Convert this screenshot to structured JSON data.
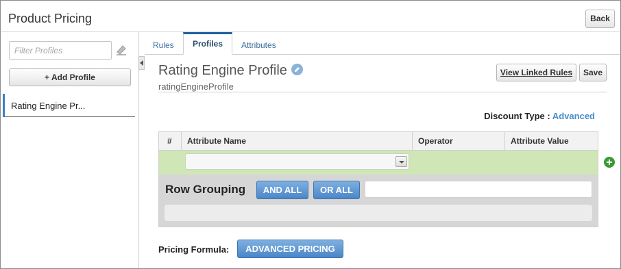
{
  "header": {
    "title": "Product Pricing",
    "back_label": "Back"
  },
  "sidebar": {
    "filter_placeholder": "Filter Profiles",
    "add_label": "+ Add Profile",
    "items": [
      {
        "label": "Rating Engine Pr..."
      }
    ]
  },
  "tabs": [
    {
      "label": "Rules"
    },
    {
      "label": "Profiles",
      "active": true
    },
    {
      "label": "Attributes"
    }
  ],
  "profile": {
    "title": "Rating Engine Profile",
    "subtitle": "ratingEngineProfile",
    "view_linked_label": "View Linked Rules",
    "save_label": "Save"
  },
  "discount": {
    "label": "Discount Type :",
    "value": "Advanced"
  },
  "table": {
    "columns": [
      "#",
      "Attribute Name",
      "Operator",
      "Attribute Value"
    ]
  },
  "grouping": {
    "label": "Row Grouping",
    "and_label": "AND ALL",
    "or_label": "OR ALL"
  },
  "pricing": {
    "label": "Pricing Formula:",
    "button_label": "ADVANCED PRICING"
  },
  "colors": {
    "accent": "#1f5f9f",
    "link": "#4a8cc8",
    "row_green": "#cfe6b6",
    "button_blue": "#4c86c8",
    "add_green": "#3a9a36"
  },
  "icons": [
    "eraser-icon",
    "collapse-arrow-icon",
    "edit-pencil-icon",
    "dropdown-arrow-icon",
    "add-circle-icon"
  ]
}
